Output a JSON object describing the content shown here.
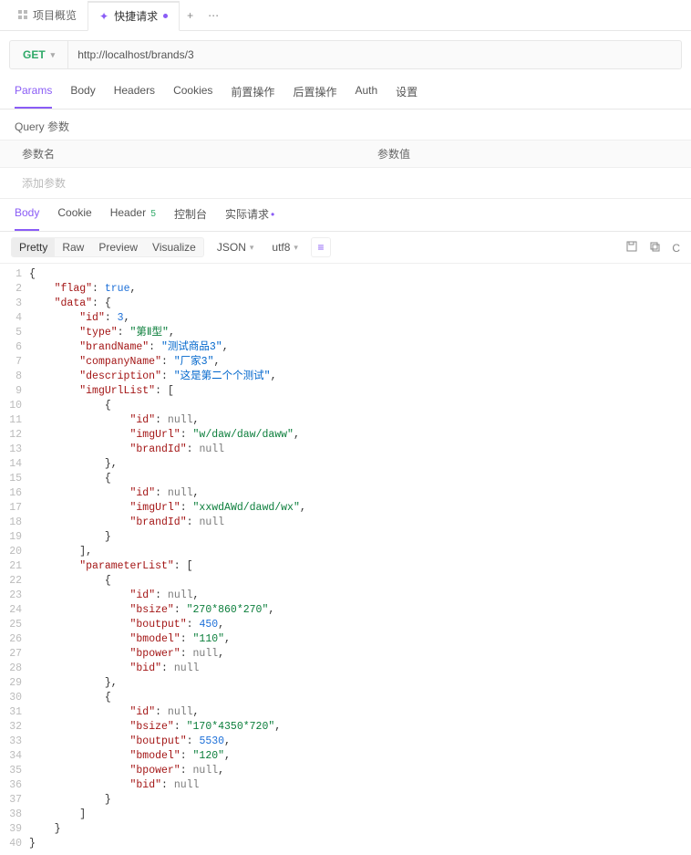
{
  "tabs": {
    "overview": {
      "label": "项目概览"
    },
    "active": {
      "label": "快捷请求"
    }
  },
  "request": {
    "method": "GET",
    "url": "http://localhost/brands/3"
  },
  "reqTabs": [
    "Params",
    "Body",
    "Headers",
    "Cookies",
    "前置操作",
    "后置操作",
    "Auth",
    "设置"
  ],
  "paramsSection": {
    "title": "Query 参数",
    "colName": "参数名",
    "colValue": "参数值",
    "addPlaceholder": "添加参数"
  },
  "resTabs": {
    "body": "Body",
    "cookie": "Cookie",
    "header": "Header",
    "headerCount": "5",
    "console": "控制台",
    "actual": "实际请求"
  },
  "resToolbar": {
    "pretty": "Pretty",
    "raw": "Raw",
    "preview": "Preview",
    "visualize": "Visualize",
    "format": "JSON",
    "encoding": "utf8"
  },
  "json_text": "{\n    \"flag\": true,\n    \"data\": {\n        \"id\": 3,\n        \"type\": \"第Ⅱ型\",\n        \"brandName\": \"测试商品3\",\n        \"companyName\": \"厂家3\",\n        \"description\": \"这是第二个个测试\",\n        \"imgUrlList\": [\n            {\n                \"id\": null,\n                \"imgUrl\": \"w/daw/daw/daww\",\n                \"brandId\": null\n            },\n            {\n                \"id\": null,\n                \"imgUrl\": \"xxwdAWd/dawd/wx\",\n                \"brandId\": null\n            }\n        ],\n        \"parameterList\": [\n            {\n                \"id\": null,\n                \"bsize\": \"270*860*270\",\n                \"boutput\": 450,\n                \"bmodel\": \"110\",\n                \"bpower\": null,\n                \"bid\": null\n            },\n            {\n                \"id\": null,\n                \"bsize\": \"170*4350*720\",\n                \"boutput\": 5530,\n                \"bmodel\": \"120\",\n                \"bpower\": null,\n                \"bid\": null\n            }\n        ]\n    }\n}"
}
